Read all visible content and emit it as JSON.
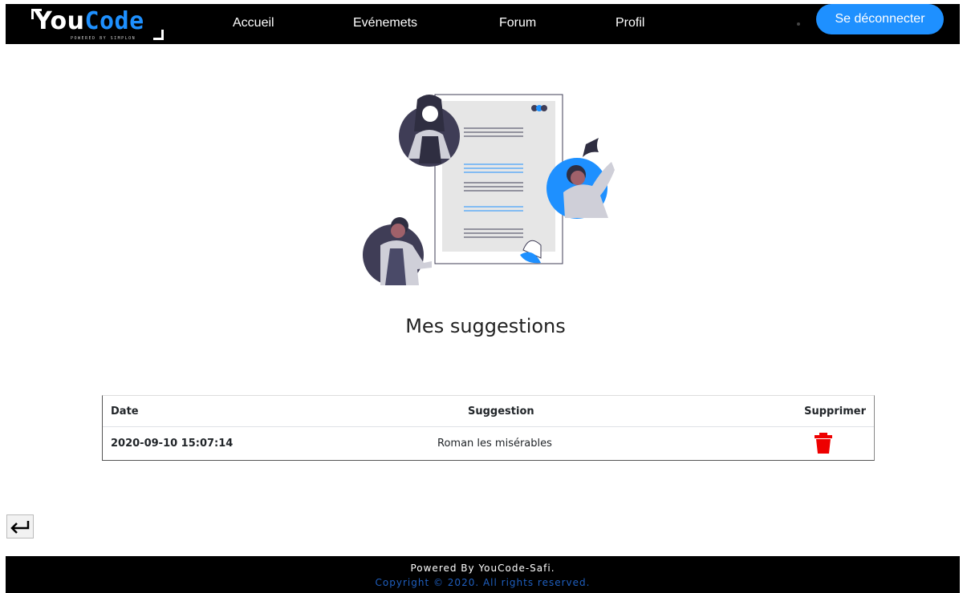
{
  "navbar": {
    "logo_you": "You",
    "logo_code": "Code",
    "logo_powered": "POWERED BY SIMPLON",
    "links": [
      "Accueil",
      "Evénemets",
      "Forum",
      "Profil"
    ],
    "logout_label": "Se déconnecter"
  },
  "page": {
    "title": "Mes suggestions"
  },
  "table": {
    "headers": [
      "Date",
      "Suggestion",
      "Supprimer"
    ],
    "rows": [
      {
        "date": "2020-09-10 15:07:14",
        "suggestion": "Roman les misérables"
      }
    ]
  },
  "footer": {
    "line1": "Powered By YouCode-Safi.",
    "line2": "Copyright © 2020. All rights reserved."
  },
  "colors": {
    "accent": "#1e90ff",
    "delete": "#ee0000"
  },
  "icons": {
    "delete": "trash-icon",
    "back": "back-arrow-icon"
  }
}
